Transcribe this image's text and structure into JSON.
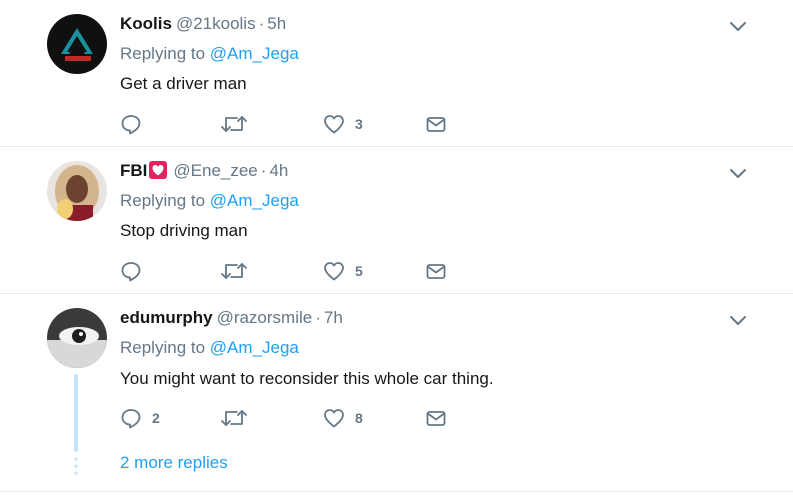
{
  "tweets": [
    {
      "name": "Koolis",
      "handle": "@21koolis",
      "separator": "·",
      "time": "5h",
      "replying_prefix": "Replying to",
      "replying_to": "@Am_Jega",
      "text": "Get a driver man",
      "reply_count": "",
      "retweet_count": "",
      "like_count": "3"
    },
    {
      "name": "FBI",
      "handle": "@Ene_zee",
      "separator": "·",
      "time": "4h",
      "replying_prefix": "Replying to",
      "replying_to": "@Am_Jega",
      "text": "Stop driving man",
      "reply_count": "",
      "retweet_count": "",
      "like_count": "5"
    },
    {
      "name": "edumurphy",
      "handle": "@razorsmile",
      "separator": "·",
      "time": "7h",
      "replying_prefix": "Replying to",
      "replying_to": "@Am_Jega",
      "text": "You might want to reconsider this whole car thing.",
      "reply_count": "2",
      "retweet_count": "",
      "like_count": "8"
    }
  ],
  "thread": {
    "more_replies_label": "2 more replies"
  },
  "colors": {
    "link": "#1da1f2",
    "muted": "#657786",
    "divider": "#e6ecf0",
    "thread_line": "#c4e3f9",
    "heart_badge": "#e0245e"
  }
}
